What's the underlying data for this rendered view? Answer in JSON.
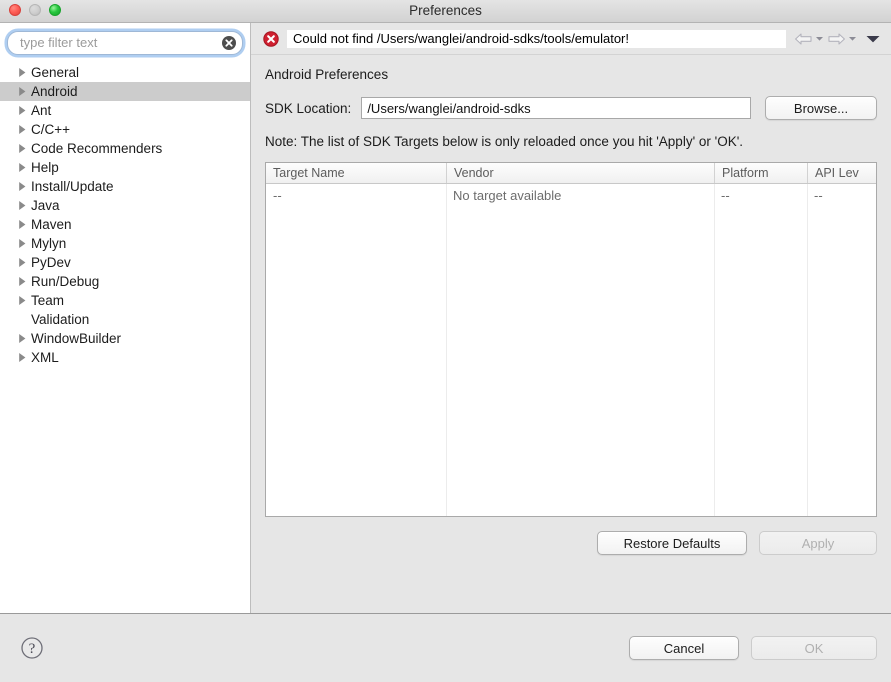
{
  "window": {
    "title": "Preferences",
    "traffic_lights": [
      "close-button",
      "minimize-button",
      "maximize-button"
    ]
  },
  "sidebar": {
    "filter": {
      "placeholder": "type filter text",
      "value": "",
      "clear_icon": "clear-circle-icon"
    },
    "items": [
      {
        "label": "General",
        "expandable": true,
        "selected": false
      },
      {
        "label": "Android",
        "expandable": true,
        "selected": true
      },
      {
        "label": "Ant",
        "expandable": true,
        "selected": false
      },
      {
        "label": "C/C++",
        "expandable": true,
        "selected": false
      },
      {
        "label": "Code Recommenders",
        "expandable": true,
        "selected": false
      },
      {
        "label": "Help",
        "expandable": true,
        "selected": false
      },
      {
        "label": "Install/Update",
        "expandable": true,
        "selected": false
      },
      {
        "label": "Java",
        "expandable": true,
        "selected": false
      },
      {
        "label": "Maven",
        "expandable": true,
        "selected": false
      },
      {
        "label": "Mylyn",
        "expandable": true,
        "selected": false
      },
      {
        "label": "PyDev",
        "expandable": true,
        "selected": false
      },
      {
        "label": "Run/Debug",
        "expandable": true,
        "selected": false
      },
      {
        "label": "Team",
        "expandable": true,
        "selected": false
      },
      {
        "label": "Validation",
        "expandable": false,
        "selected": false
      },
      {
        "label": "WindowBuilder",
        "expandable": true,
        "selected": false
      },
      {
        "label": "XML",
        "expandable": true,
        "selected": false
      }
    ]
  },
  "statusbar": {
    "error_icon": "error-circle-icon",
    "message": "Could not find /Users/wanglei/android-sdks/tools/emulator!",
    "back_icon": "back-arrow-icon",
    "back_dropdown_icon": "chevron-down-icon",
    "forward_icon": "forward-arrow-icon",
    "forward_dropdown_icon": "chevron-down-icon",
    "menu_icon": "dropdown-triangle-icon"
  },
  "main": {
    "section_title": "Android Preferences",
    "sdk_location_label": "SDK Location:",
    "sdk_location_value": "/Users/wanglei/android-sdks",
    "sdk_location_placeholder": "",
    "browse_label": "Browse...",
    "note": "Note: The list of SDK Targets below is only reloaded once you hit 'Apply' or 'OK'.",
    "table": {
      "columns": [
        "Target Name",
        "Vendor",
        "Platform",
        "API Lev"
      ],
      "rows": [
        [
          "--",
          "No target available",
          "--",
          "--"
        ]
      ]
    },
    "restore_defaults_label": "Restore Defaults",
    "apply_label": "Apply",
    "apply_enabled": false
  },
  "footer": {
    "help_icon": "help-question-icon",
    "cancel_label": "Cancel",
    "ok_label": "OK",
    "ok_enabled": false
  },
  "colors": {
    "error_red": "#d0021b",
    "selection_gray": "#cccccc",
    "focus_blue": "#6ea5e6",
    "window_bg": "#e6e6e6",
    "sidebar_bg": "#ffffff"
  }
}
